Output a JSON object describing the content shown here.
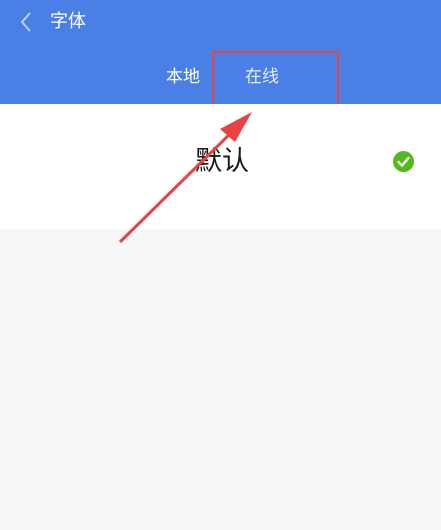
{
  "header": {
    "title": "字体",
    "back_icon": "chevron-left-icon",
    "background": "#4a80e6"
  },
  "tabs": [
    {
      "label": "本地"
    },
    {
      "label": "在线"
    }
  ],
  "fonts": [
    {
      "name": "默认",
      "selected": true
    }
  ],
  "annotation": {
    "color": "#e8433e"
  },
  "colors": {
    "check": "#52b81c",
    "page_bg": "#f7f7f7"
  }
}
